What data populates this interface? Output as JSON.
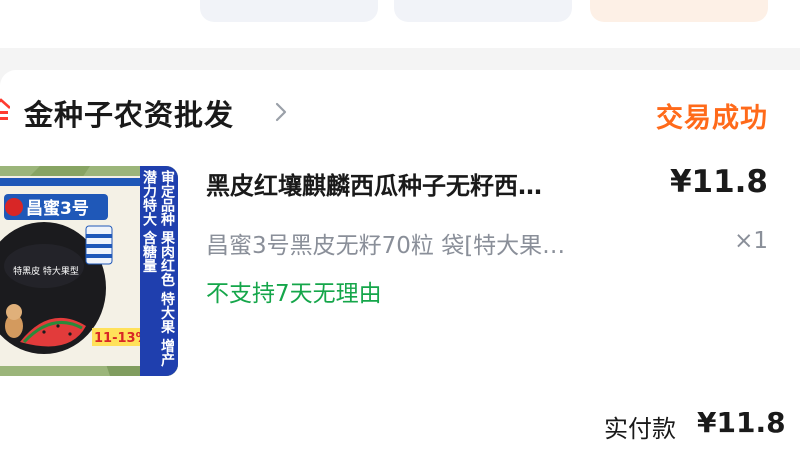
{
  "shop": {
    "name": "金种子农资批发"
  },
  "order": {
    "status": "交易成功",
    "paid_label": "实付款",
    "paid_amount": "¥11.8"
  },
  "product": {
    "title": "黑皮红壤麒麟西瓜种子无籽西…",
    "price": "¥11.8",
    "spec": "昌蜜3号黑皮无籽70粒 袋[特大果…",
    "quantity": "×1",
    "return_policy": "不支持7天无理由"
  },
  "thumbnail": {
    "brand": "昌蜜3号",
    "feature_text": "审定品种 果肉红色 特大果 增产潜力特大 含糖量",
    "badge_text": "特黑皮 特大果型",
    "sugar_percent": "11-13%"
  },
  "colors": {
    "status": "#ff6a1a",
    "policy": "#15a64a",
    "secondary": "#8a8f99"
  }
}
